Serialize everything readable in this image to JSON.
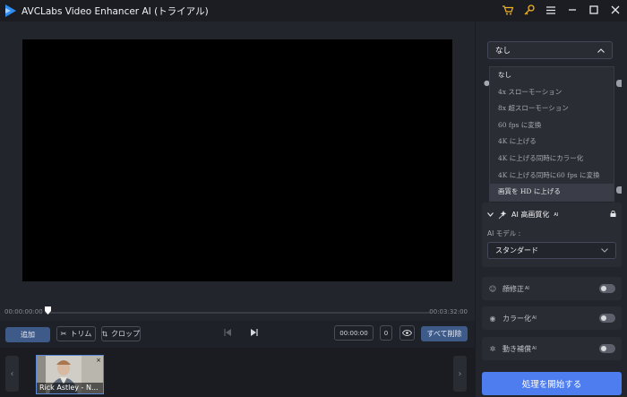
{
  "app": {
    "title": "AVCLabs Video Enhancer AI (トライアル)"
  },
  "titlebar_icons": [
    "cart-icon",
    "key-icon",
    "menu-icon",
    "minimize-icon",
    "maximize-icon",
    "close-icon"
  ],
  "timeline": {
    "start": "00:00:00:00",
    "end": "00:03:32:00"
  },
  "controls": {
    "add_label": "追加",
    "trim_label": "トリム",
    "crop_label": "クロップ",
    "time_value": "00:00:00",
    "frame_value": "0",
    "delete_all_label": "すべて削除"
  },
  "thumbnail": {
    "label": "Rick Astley - N...",
    "close": "×"
  },
  "frame_interpolation": {
    "selected": "なし",
    "options": [
      "なし",
      "4x スローモーション",
      "8x 超スローモーション",
      "60 fps に変換",
      "4K に上げる",
      "4K に上げる同時にカラー化",
      "4K に上げる同時に60 fps に変換",
      "画質を HD に上げる"
    ]
  },
  "ai_enhance": {
    "title": "AI 高画質化",
    "sup": "AI",
    "model_label": "AI モデル :",
    "model_value": "スタンダード"
  },
  "features": [
    {
      "label": "顔修正",
      "sup": "AI",
      "on": false
    },
    {
      "label": "カラー化",
      "sup": "AI",
      "on": false
    },
    {
      "label": "動き補償",
      "sup": "AI",
      "on": false
    }
  ],
  "start_button": "処理を開始する",
  "colors": {
    "accent": "#4e7df0",
    "button": "#3d5a88",
    "gold": "#f0b323"
  }
}
